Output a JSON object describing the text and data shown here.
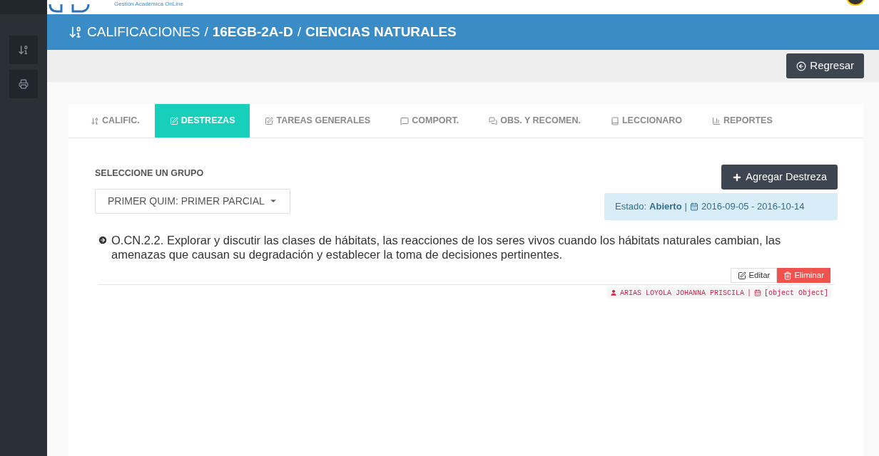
{
  "logo": {
    "tagline": "Gestión Académica OnLine"
  },
  "title": {
    "section": "CALIFICACIONES",
    "separator": "/",
    "course": "16EGB-2A-D",
    "subject": "CIENCIAS NATURALES"
  },
  "sidebar": {
    "items": [
      {
        "kind": "sort"
      },
      {
        "kind": "print"
      }
    ]
  },
  "back_button": "Regresar",
  "tabs": [
    {
      "label": "CALIFIC.",
      "kind": "sort",
      "selected": false
    },
    {
      "label": "DESTREZAS",
      "kind": "edit",
      "selected": true
    },
    {
      "label": "TAREAS GENERALES",
      "kind": "edit",
      "selected": false
    },
    {
      "label": "COMPORT.",
      "kind": "comment",
      "selected": false
    },
    {
      "label": "OBS. Y RECOMEN.",
      "kind": "comments",
      "selected": false
    },
    {
      "label": "LECCIONARO",
      "kind": "book",
      "selected": false
    },
    {
      "label": "REPORTES",
      "kind": "chart",
      "selected": false
    }
  ],
  "group": {
    "label": "SELECCIONE UN GRUPO",
    "value": "PRIMER QUIM: PRIMER PARCIAL"
  },
  "add_button": "Agregar Destreza",
  "status": {
    "label": "Estado:",
    "value": "Abierto",
    "separator": "|",
    "dates": "2016-09-05 - 2016-10-14"
  },
  "skills": [
    {
      "text": "O.CN.2.2. Explorar y discutir las clases de hábitats, las reacciones de los seres vivos cuando los hábitats naturales cambian, las amenazas que causan su degradación y establecer la toma de decisiones pertinentes.",
      "edit": "Editar",
      "delete": "Eliminar",
      "author": "ARIAS LOYOLA JOHANNA PRISCILA",
      "separator": "|",
      "date": "[object Object]"
    }
  ]
}
